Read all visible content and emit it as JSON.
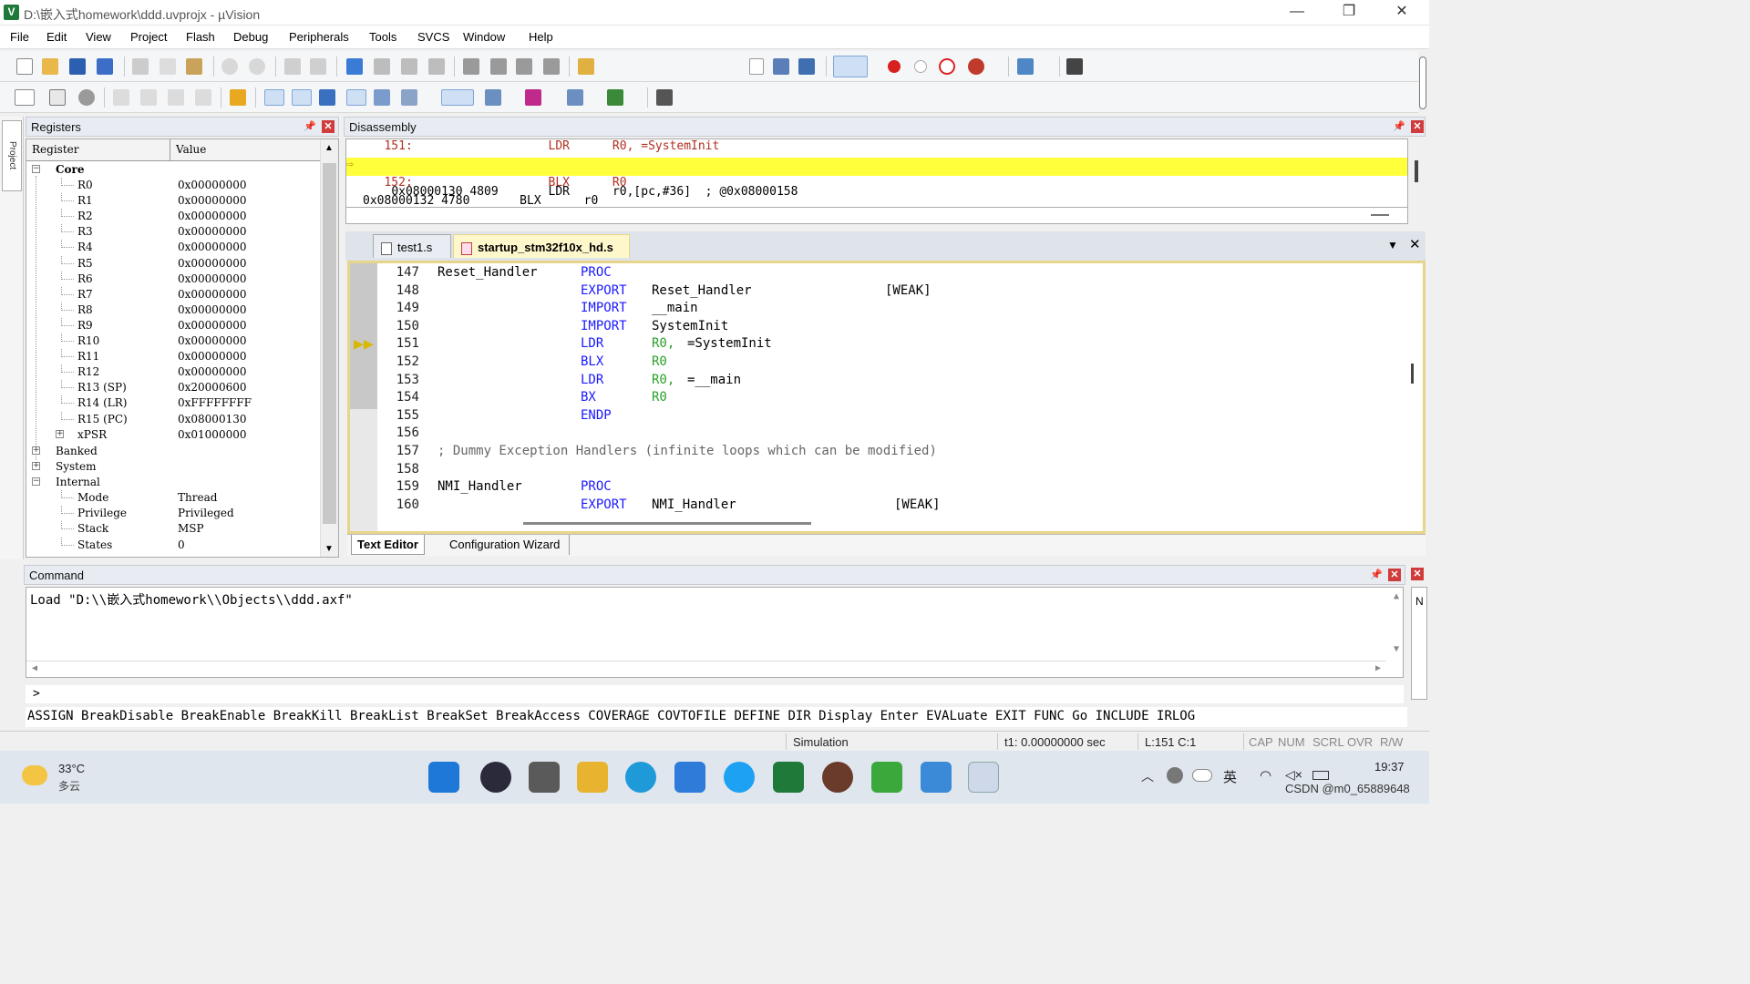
{
  "window": {
    "title": "D:\\嵌入式homework\\ddd.uvprojx - µVision",
    "app_icon": "V",
    "minimize": "—",
    "restore": "❐",
    "close": "✕"
  },
  "menu": [
    "File",
    "Edit",
    "View",
    "Project",
    "Flash",
    "Debug",
    "Peripherals",
    "Tools",
    "SVCS",
    "Window",
    "Help"
  ],
  "left_strip": {
    "label": "Project"
  },
  "registers": {
    "title": "Registers",
    "col_register": "Register",
    "col_value": "Value",
    "core_label": "Core",
    "core": [
      {
        "name": "R0",
        "value": "0x00000000"
      },
      {
        "name": "R1",
        "value": "0x00000000"
      },
      {
        "name": "R2",
        "value": "0x00000000"
      },
      {
        "name": "R3",
        "value": "0x00000000"
      },
      {
        "name": "R4",
        "value": "0x00000000"
      },
      {
        "name": "R5",
        "value": "0x00000000"
      },
      {
        "name": "R6",
        "value": "0x00000000"
      },
      {
        "name": "R7",
        "value": "0x00000000"
      },
      {
        "name": "R8",
        "value": "0x00000000"
      },
      {
        "name": "R9",
        "value": "0x00000000"
      },
      {
        "name": "R10",
        "value": "0x00000000"
      },
      {
        "name": "R11",
        "value": "0x00000000"
      },
      {
        "name": "R12",
        "value": "0x00000000"
      },
      {
        "name": "R13 (SP)",
        "value": "0x20000600"
      },
      {
        "name": "R14 (LR)",
        "value": "0xFFFFFFFF"
      },
      {
        "name": "R15 (PC)",
        "value": "0x08000130"
      },
      {
        "name": "xPSR",
        "value": "0x01000000"
      }
    ],
    "banked_label": "Banked",
    "system_label": "System",
    "internal_label": "Internal",
    "internal": [
      {
        "name": "Mode",
        "value": "Thread"
      },
      {
        "name": "Privilege",
        "value": "Privileged"
      },
      {
        "name": "Stack",
        "value": "MSP"
      },
      {
        "name": "States",
        "value": "0"
      }
    ]
  },
  "disassembly": {
    "title": "Disassembly",
    "lines": [
      "   151:                   LDR      R0, =SystemInit",
      "0x08000130 4809       LDR      r0,[pc,#36]  ; @0x08000158",
      "   152:                   BLX      R0",
      "0x08000132 4780       BLX      r0"
    ]
  },
  "editor": {
    "tabs": [
      "test1.s",
      "startup_stm32f10x_hd.s"
    ],
    "active_tab": 1,
    "lines": [
      {
        "num": "147",
        "label": "Reset_Handler",
        "op": "PROC",
        "args": "",
        "extra": ""
      },
      {
        "num": "148",
        "label": "",
        "op": "EXPORT",
        "args": "Reset_Handler",
        "extra": "[WEAK]"
      },
      {
        "num": "149",
        "label": "",
        "op": "IMPORT",
        "args": "__main",
        "extra": ""
      },
      {
        "num": "150",
        "label": "",
        "op": "IMPORT",
        "args": "SystemInit",
        "extra": ""
      },
      {
        "num": "151",
        "label": "",
        "op": "LDR",
        "reg": "R0,",
        "args": "=SystemInit",
        "extra": ""
      },
      {
        "num": "152",
        "label": "",
        "op": "BLX",
        "reg": "R0",
        "args": "",
        "extra": ""
      },
      {
        "num": "153",
        "label": "",
        "op": "LDR",
        "reg": "R0,",
        "args": "=__main",
        "extra": ""
      },
      {
        "num": "154",
        "label": "",
        "op": "BX",
        "reg": "R0",
        "args": "",
        "extra": ""
      },
      {
        "num": "155",
        "label": "",
        "op": "ENDP",
        "args": "",
        "extra": ""
      },
      {
        "num": "156",
        "label": "",
        "op": "",
        "args": "",
        "extra": ""
      },
      {
        "num": "157",
        "comment": "; Dummy Exception Handlers (infinite loops which can be modified)"
      },
      {
        "num": "158",
        "label": "",
        "op": "",
        "args": "",
        "extra": ""
      },
      {
        "num": "159",
        "label": "NMI_Handler",
        "op": "PROC",
        "args": "",
        "extra": ""
      },
      {
        "num": "160",
        "label": "",
        "op": "EXPORT",
        "args": "NMI_Handler",
        "extra": "[WEAK]"
      }
    ],
    "bottom_tabs": [
      "Text Editor",
      "Configuration Wizard"
    ]
  },
  "command": {
    "title": "Command",
    "output": "Load \"D:\\\\嵌入式homework\\\\Objects\\\\ddd.axf\"",
    "prompt": ">",
    "help": "ASSIGN BreakDisable BreakEnable BreakKill BreakList BreakSet BreakAccess COVERAGE COVTOFILE DEFINE DIR Display Enter EVALuate EXIT FUNC Go INCLUDE IRLOG"
  },
  "status": {
    "mode": "Simulation",
    "time": "t1: 0.00000000 sec",
    "pos": "L:151 C:1",
    "cap": "CAP",
    "num": "NUM",
    "scrl": "SCRL",
    "ovr": "OVR",
    "rw": "R/W"
  },
  "taskbar": {
    "temp": "33°C",
    "weather": "多云",
    "time": "19:37",
    "watermark": "CSDN @m0_65889648",
    "ime": "英"
  },
  "colors": {
    "highlight": "#ffff3c",
    "keyword": "#1a1aff",
    "register": "#2aa02a",
    "close_red": "#d03c3c"
  }
}
